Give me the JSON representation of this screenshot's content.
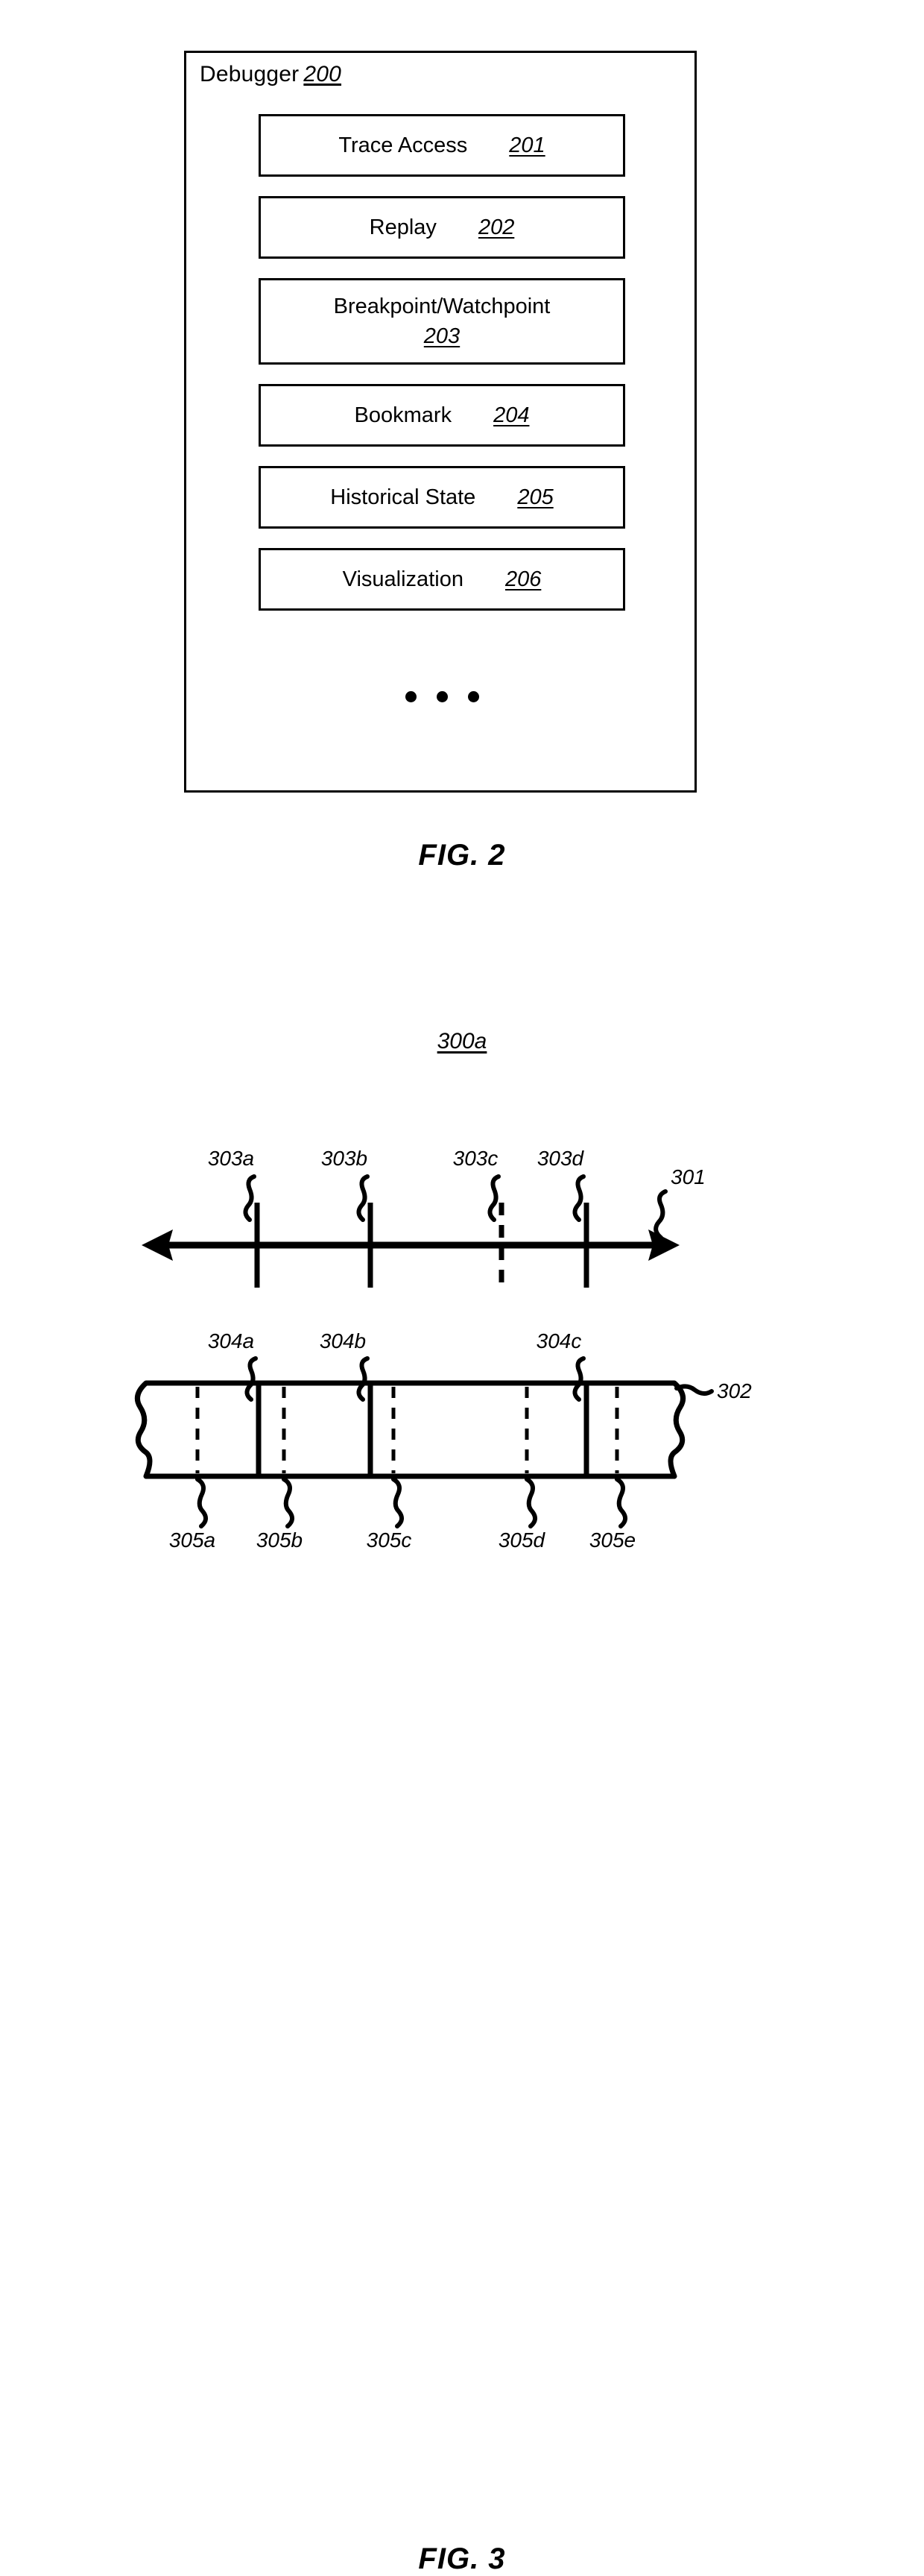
{
  "figure2": {
    "caption": "FIG. 2",
    "container": {
      "title": "Debugger",
      "ref": "200"
    },
    "modules": [
      {
        "label": "Trace Access",
        "ref": "201",
        "stacked": false
      },
      {
        "label": "Replay",
        "ref": "202",
        "stacked": false
      },
      {
        "label": "Breakpoint/Watchpoint",
        "ref": "203",
        "stacked": true
      },
      {
        "label": "Bookmark",
        "ref": "204",
        "stacked": false
      },
      {
        "label": "Historical State",
        "ref": "205",
        "stacked": false
      },
      {
        "label": "Visualization",
        "ref": "206",
        "stacked": false
      }
    ],
    "ellipsis": "• • •"
  },
  "figure3": {
    "caption": "FIG. 3",
    "title_ref": "300a",
    "timeline": {
      "ref": "301",
      "ticks": [
        {
          "label": "303a",
          "style": "solid"
        },
        {
          "label": "303b",
          "style": "solid"
        },
        {
          "label": "303c",
          "style": "dashed"
        },
        {
          "label": "303d",
          "style": "solid"
        }
      ]
    },
    "trace_bar": {
      "ref": "302",
      "solid_dividers": [
        {
          "label": "304a"
        },
        {
          "label": "304b"
        },
        {
          "label": "304c"
        }
      ],
      "dashed_dividers": [
        {
          "label": "305a"
        },
        {
          "label": "305b"
        },
        {
          "label": "305c"
        },
        {
          "label": "305d"
        },
        {
          "label": "305e"
        }
      ]
    }
  }
}
